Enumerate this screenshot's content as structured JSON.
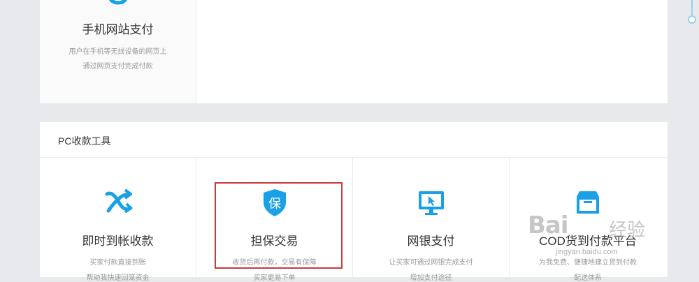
{
  "top_card": {
    "title": "手机网站支付",
    "desc_line1": "用户在手机等无线设备的网页上",
    "desc_line2": "通过网页支付完成付款",
    "icon": "mobile-pay-icon"
  },
  "section": {
    "title": "PC收款工具"
  },
  "tools": [
    {
      "name": "即时到帐收款",
      "line1": "买家付款直接到账",
      "line2": "帮助我快速回笼资金",
      "icon": "instant-transfer-icon"
    },
    {
      "name": "担保交易",
      "line1": "收货后再付款，交易有保障",
      "line2": "买家更易下单",
      "icon": "shield-guarantee-icon",
      "icon_text": "保"
    },
    {
      "name": "网银支付",
      "line1": "让买家可通过网银完成支付",
      "line2": "增加支付途径",
      "icon": "monitor-icon"
    },
    {
      "name": "COD货到付款平台",
      "line1": "为我免费、便捷地建立货到付款",
      "line2": "配送体系",
      "icon": "box-icon"
    }
  ],
  "watermark": {
    "brand": "Bai",
    "cn": "经验",
    "url": "jingyan.baidu.com"
  },
  "colors": {
    "accent": "#1aa0e6",
    "highlight": "#c9393a",
    "background": "#e8e9ec"
  }
}
